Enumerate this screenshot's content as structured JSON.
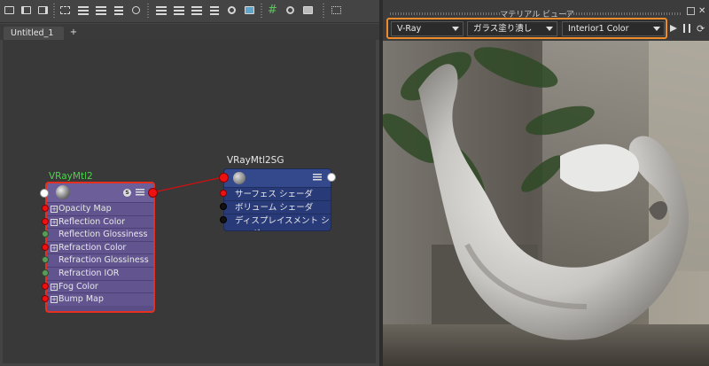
{
  "graph": {
    "tab_label": "Untitled_1",
    "add_tab_label": "+",
    "toolbar_icons": [
      "frame-icon",
      "input-connections-icon",
      "output-connections-icon",
      "graph-icon",
      "arrange-icon",
      "grid-snap-icon",
      "layout-icon",
      "list-icon",
      "search-icon",
      "swatch-icon",
      "grid-icon",
      "filter-icon",
      "node-icon"
    ],
    "material_node": {
      "title": "VRayMtl2",
      "attributes": [
        {
          "label": "Opacity Map",
          "expandable": true,
          "port": "red"
        },
        {
          "label": "Reflection Color",
          "expandable": true,
          "port": "red"
        },
        {
          "label": "Reflection Glossiness",
          "expandable": false,
          "port": "green"
        },
        {
          "label": "Refraction Color",
          "expandable": true,
          "port": "red"
        },
        {
          "label": "Refraction Glossiness",
          "expandable": false,
          "port": "green"
        },
        {
          "label": "Refraction IOR",
          "expandable": false,
          "port": "green"
        },
        {
          "label": "Fog Color",
          "expandable": true,
          "port": "red"
        },
        {
          "label": "Bump Map",
          "expandable": true,
          "port": "red"
        }
      ],
      "badge": "S"
    },
    "shading_group_node": {
      "title": "VRayMtl2SG",
      "attributes": [
        {
          "label": "サーフェス シェーダ",
          "port": "red"
        },
        {
          "label": "ボリューム シェーダ",
          "port": "black"
        },
        {
          "label": "ディスプレイスメント シェーダ",
          "port": "black"
        }
      ]
    },
    "colors": {
      "material_border": "#e53020",
      "material_title": "#4cd44c",
      "connection": "#d01010",
      "sg_body": "#283a78"
    }
  },
  "viewer": {
    "title": "マテリアル ビューア",
    "renderer": "V-Ray",
    "shape": "ガラス塗り潰し",
    "environment": "Interior1 Color",
    "highlight_color": "#ee8c2c",
    "controls": [
      "play-icon",
      "pause-icon",
      "refresh-icon"
    ]
  }
}
